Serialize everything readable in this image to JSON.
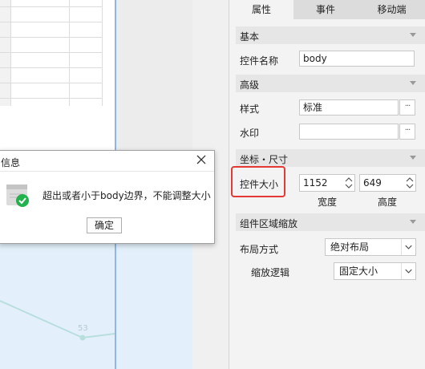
{
  "dialog": {
    "title": "信息",
    "message": "超出或者小于body边界，不能调整大小",
    "ok_label": "确定"
  },
  "chart": {
    "point_label": "53"
  },
  "panel": {
    "tabs": [
      "属性",
      "事件",
      "移动端"
    ],
    "sections": {
      "basic": "基本",
      "advanced": "高级",
      "coord_size": "坐标・尺寸",
      "component_scale": "组件区域缩放"
    },
    "widget_name_label": "控件名称",
    "widget_name_value": "body",
    "style_label": "样式",
    "style_value": "标准",
    "watermark_label": "水印",
    "watermark_value": "",
    "dots": "···",
    "size_label": "控件大小",
    "width_value": "1152",
    "height_value": "649",
    "width_label": "宽度",
    "height_label": "高度",
    "layout_label": "布局方式",
    "layout_value": "绝对布局",
    "scale_label": "缩放逻辑",
    "scale_value": "固定大小"
  },
  "colors": {
    "accent_blue": "#8fb6e4",
    "success_green": "#22b14c",
    "highlight_red": "#e53935"
  }
}
